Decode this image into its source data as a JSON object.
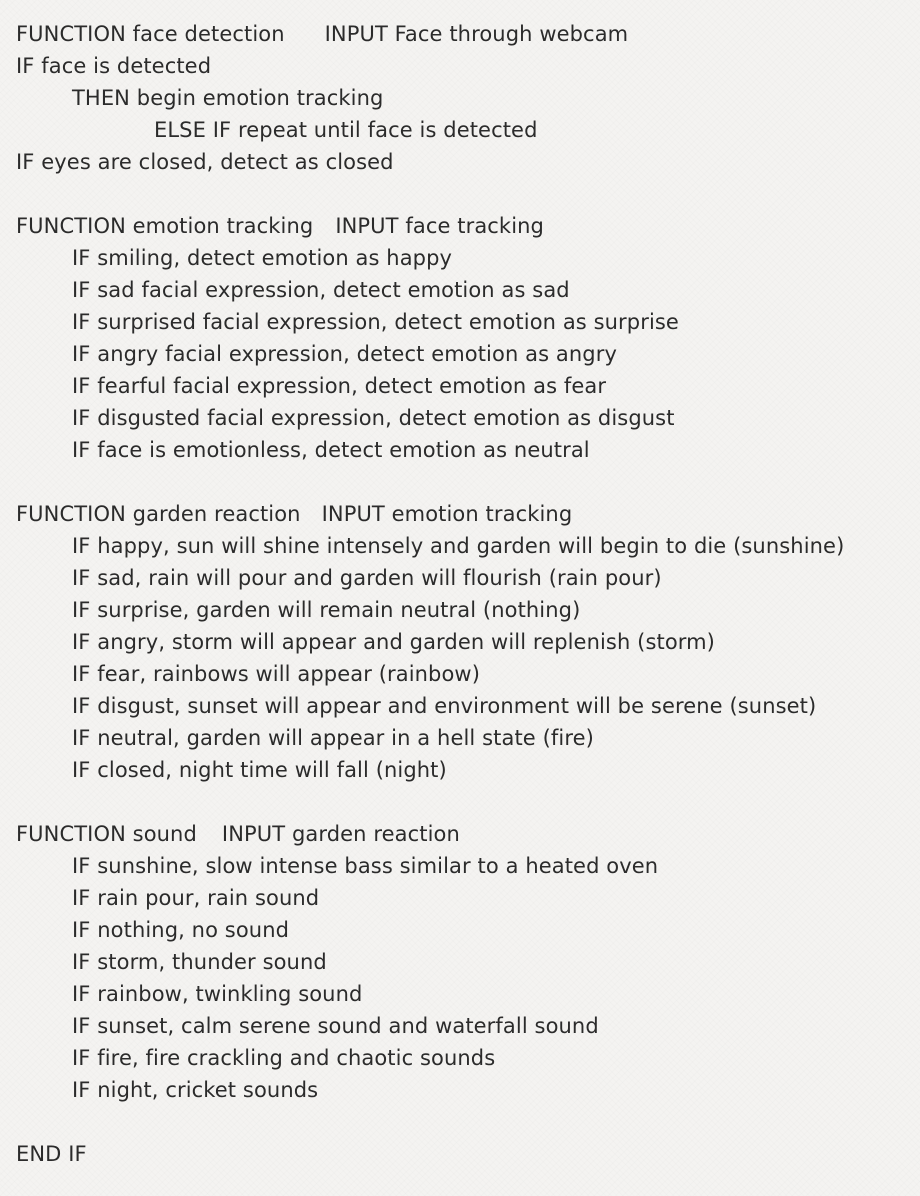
{
  "face": {
    "header": "FUNCTION face detection",
    "input": "INPUT Face through webcam",
    "lines": [
      "IF face is detected",
      "THEN begin emotion tracking",
      "ELSE IF repeat until face is detected",
      "IF eyes are closed, detect as closed"
    ]
  },
  "emotion": {
    "header": "FUNCTION emotion tracking",
    "input": "INPUT face tracking",
    "lines": [
      "IF smiling, detect emotion as happy",
      "IF sad facial expression, detect emotion as sad",
      "IF surprised facial expression, detect emotion as surprise",
      "IF angry facial expression, detect emotion as angry",
      "IF fearful facial expression, detect emotion as fear",
      "IF disgusted facial expression, detect emotion as disgust",
      "IF face is emotionless, detect emotion as neutral"
    ]
  },
  "garden": {
    "header": "FUNCTION garden reaction",
    "input": "INPUT emotion tracking",
    "lines": [
      "IF happy, sun will shine intensely and garden will begin to die (sunshine)",
      "IF sad, rain will pour and garden will flourish (rain pour)",
      "IF surprise, garden will remain neutral (nothing)",
      "IF angry, storm will appear and garden will replenish (storm)",
      "IF fear, rainbows will appear (rainbow)",
      "IF disgust, sunset will appear and environment will be serene (sunset)",
      "IF neutral, garden will appear in a hell state (fire)",
      "IF closed, night time will fall (night)"
    ]
  },
  "sound": {
    "header": "FUNCTION sound",
    "input": "INPUT garden reaction",
    "lines": [
      "IF sunshine, slow intense bass similar to a heated oven",
      "IF rain pour, rain sound",
      "IF nothing, no sound",
      "IF storm, thunder sound",
      "IF rainbow, twinkling sound",
      "IF sunset, calm serene sound and waterfall sound",
      "IF fire, fire crackling and chaotic sounds",
      "IF night, cricket sounds"
    ]
  },
  "end": "END IF"
}
